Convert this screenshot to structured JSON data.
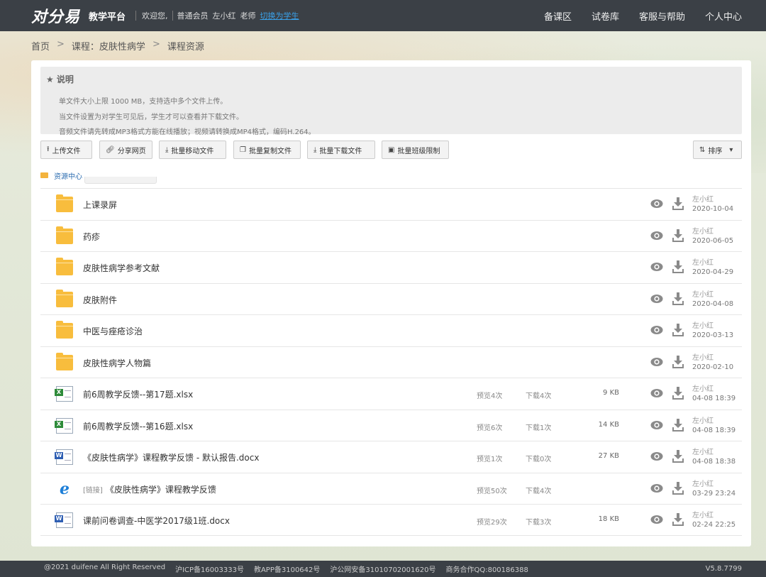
{
  "header": {
    "logo": "对分易",
    "platform": "教学平台",
    "welcome": "欢迎您,",
    "member": "普通会员",
    "user": "左小红",
    "role": "老师",
    "switch_link": "切换为学生",
    "nav": [
      "备课区",
      "试卷库",
      "客服与帮助",
      "个人中心"
    ]
  },
  "breadcrumb": [
    "首页",
    "课程：皮肤性病学",
    "课程资源"
  ],
  "breadcrumb_sep": ">",
  "notice": {
    "title": "★ 说明",
    "lines": [
      "单文件大小上限 1000 MB，支持选中多个文件上传。",
      "当文件设置为对学生可见后，学生才可以查看并下载文件。",
      "音频文件请先转成MP3格式方能在线播放；视频请转换成MP4格式，编码H.264。"
    ]
  },
  "toolbar": {
    "upload": "上传文件",
    "share": "分享网页",
    "move": "批量移动文件",
    "copy": "批量复制文件",
    "download": "批量下载文件",
    "limit": "批量班级限制",
    "sort": "排序"
  },
  "folder_path": "资源中心",
  "rows": [
    {
      "type": "folder",
      "name": "上课录屏",
      "owner": "左小红",
      "date": "2020-10-04"
    },
    {
      "type": "folder",
      "name": "药疹",
      "owner": "左小红",
      "date": "2020-06-05"
    },
    {
      "type": "folder",
      "name": "皮肤性病学参考文献",
      "owner": "左小红",
      "date": "2020-04-29"
    },
    {
      "type": "folder",
      "name": "皮肤附件",
      "owner": "左小红",
      "date": "2020-04-08"
    },
    {
      "type": "folder",
      "name": "中医与痤疮诊治",
      "owner": "左小红",
      "date": "2020-03-13"
    },
    {
      "type": "folder",
      "name": "皮肤性病学人物篇",
      "owner": "左小红",
      "date": "2020-02-10"
    },
    {
      "type": "xls",
      "name": "前6周教学反馈--第17题.xlsx",
      "preview": "预览4次",
      "download": "下载4次",
      "size": "9 KB",
      "owner": "左小红",
      "date": "04-08 18:39"
    },
    {
      "type": "xls",
      "name": "前6周教学反馈--第16题.xlsx",
      "preview": "预览6次",
      "download": "下载1次",
      "size": "14 KB",
      "owner": "左小红",
      "date": "04-08 18:39"
    },
    {
      "type": "doc",
      "name": "《皮肤性病学》课程教学反馈 - 默认报告.docx",
      "preview": "预览1次",
      "download": "下载0次",
      "size": "27 KB",
      "owner": "左小红",
      "date": "04-08 18:38"
    },
    {
      "type": "link",
      "link_tag": "[链接]",
      "name": "《皮肤性病学》课程教学反馈",
      "preview": "预览50次",
      "download": "下载4次",
      "size": "",
      "owner": "左小红",
      "date": "03-29 23:24"
    },
    {
      "type": "doc",
      "name": "课前问卷调查-中医学2017级1班.docx",
      "preview": "预览29次",
      "download": "下载3次",
      "size": "18 KB",
      "owner": "左小红",
      "date": "02-24 22:25"
    }
  ],
  "footer": {
    "copyright": "@2021 duifene All Right Reserved",
    "icp": "沪ICP备16003333号",
    "app": "教APP备3100642号",
    "police": "沪公网安备31010702001620号",
    "qq": "商务合作QQ:800186388",
    "version": "V5.8.7799"
  }
}
